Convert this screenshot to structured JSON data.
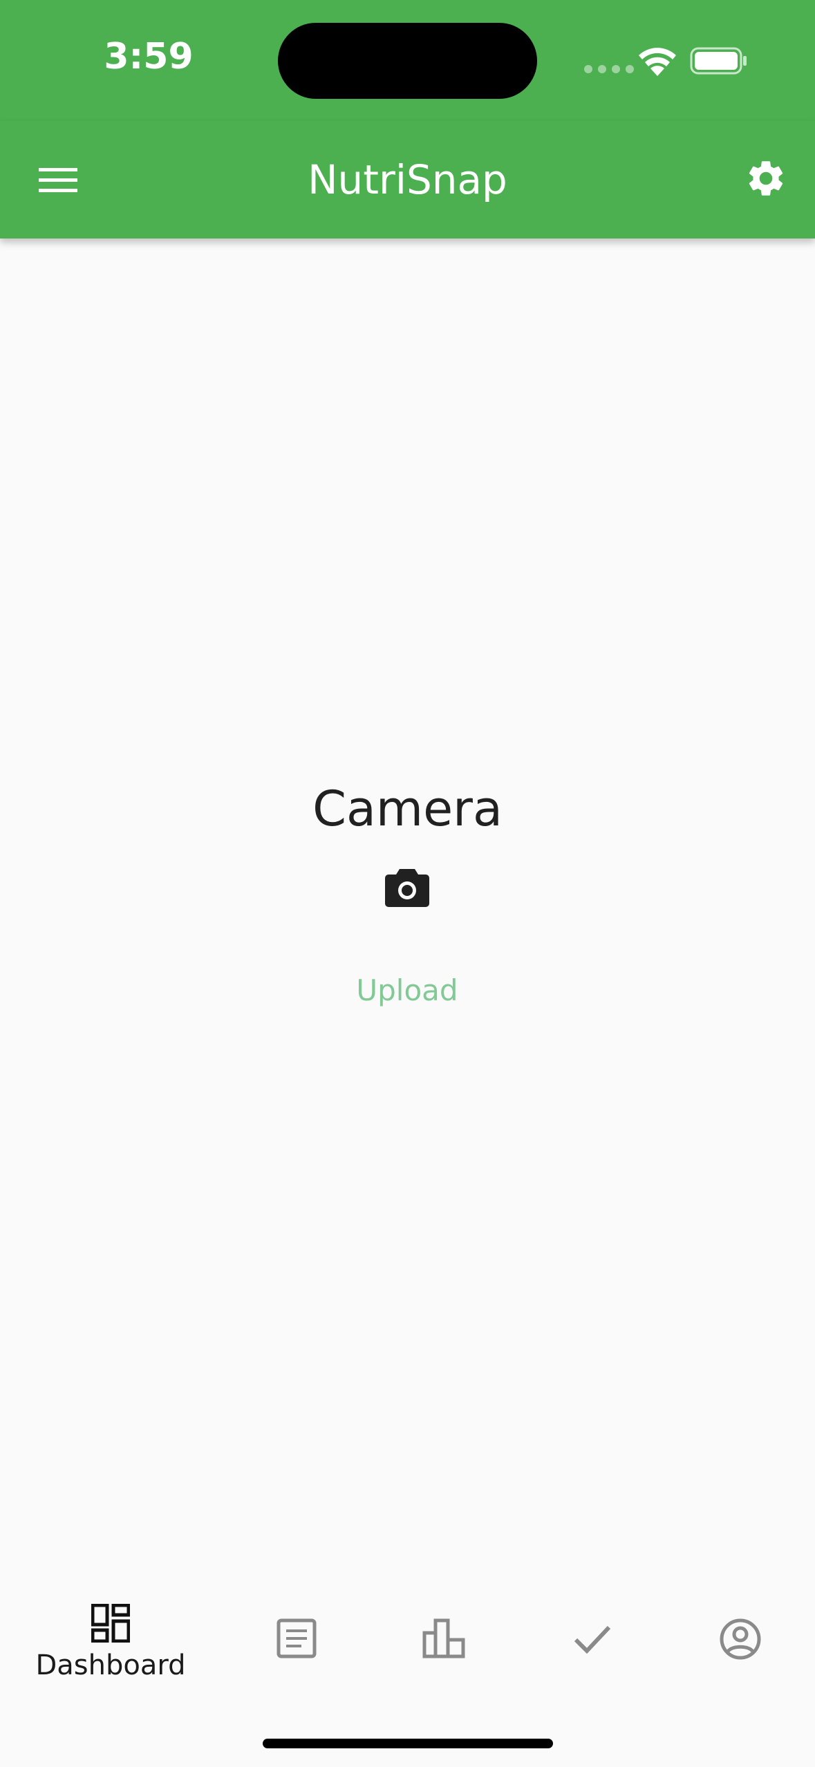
{
  "status_bar": {
    "time": "3:59"
  },
  "app_bar": {
    "title": "NutriSnap",
    "menu_icon": "hamburger-menu-icon",
    "settings_icon": "gear-icon",
    "color": "#4caf50"
  },
  "main": {
    "title": "Camera",
    "icon": "camera-icon",
    "upload_label": "Upload",
    "upload_color": "#81c995"
  },
  "bottom_nav": {
    "items": [
      {
        "label": "Dashboard",
        "icon": "dashboard-icon",
        "selected": true
      },
      {
        "icon": "article-icon",
        "selected": false
      },
      {
        "icon": "bar-chart-icon",
        "selected": false
      },
      {
        "icon": "check-icon",
        "selected": false
      },
      {
        "icon": "account-circle-icon",
        "selected": false
      }
    ]
  }
}
